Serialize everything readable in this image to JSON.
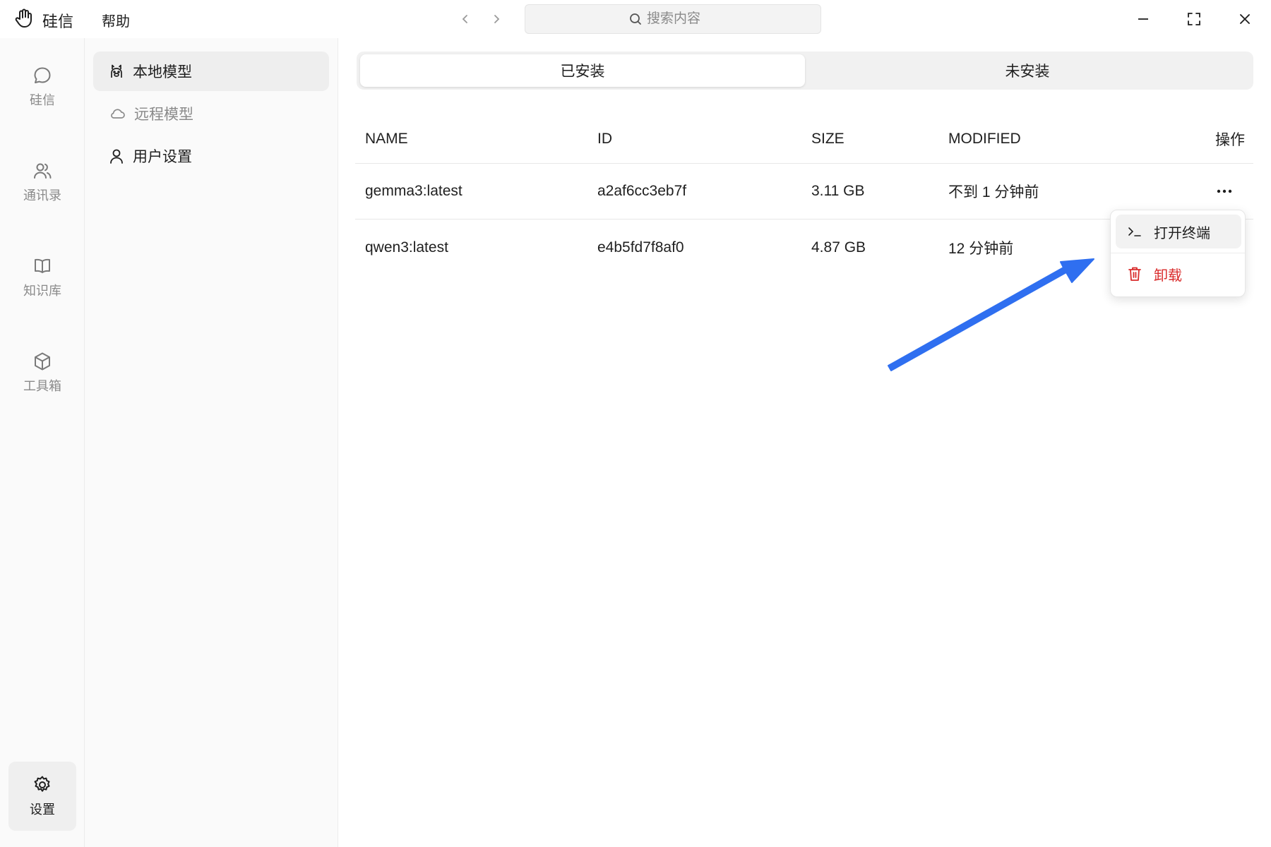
{
  "titlebar": {
    "app_name": "硅信",
    "menu_help": "帮助",
    "search": {
      "placeholder": "搜索内容"
    }
  },
  "rail": {
    "items": [
      {
        "label": "硅信",
        "icon": "chat-bubble-icon"
      },
      {
        "label": "通讯录",
        "icon": "contacts-icon"
      },
      {
        "label": "知识库",
        "icon": "book-icon"
      },
      {
        "label": "工具箱",
        "icon": "cube-icon"
      }
    ],
    "settings": {
      "label": "设置",
      "icon": "gear-icon"
    }
  },
  "subnav": {
    "items": [
      {
        "label": "本地模型",
        "icon": "llama-icon",
        "active": true
      },
      {
        "label": "远程模型",
        "icon": "cloud-icon",
        "active": false
      },
      {
        "label": "用户设置",
        "icon": "user-icon",
        "active": false
      }
    ]
  },
  "tabs": {
    "installed": "已安装",
    "not_installed": "未安装",
    "active": "installed"
  },
  "table": {
    "headers": {
      "name": "NAME",
      "id": "ID",
      "size": "SIZE",
      "modified": "MODIFIED",
      "actions": "操作"
    },
    "rows": [
      {
        "name": "gemma3:latest",
        "id": "a2af6cc3eb7f",
        "size": "3.11 GB",
        "modified": "不到 1 分钟前"
      },
      {
        "name": "qwen3:latest",
        "id": "e4b5fd7f8af0",
        "size": "4.87 GB",
        "modified": "12 分钟前"
      }
    ]
  },
  "context_menu": {
    "open_terminal": "打开终端",
    "uninstall": "卸载",
    "uninstall_color": "#d92b2b"
  },
  "annotation": {
    "arrow_color": "#2f6ff0"
  }
}
